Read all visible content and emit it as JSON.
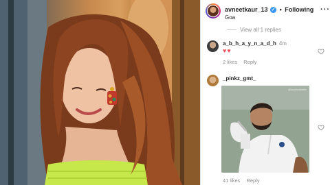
{
  "post": {
    "username": "avneetkaur_13",
    "follow_status": "Following",
    "location": "Goa"
  },
  "replies": {
    "view_label": "View all 1 replies"
  },
  "comments": [
    {
      "username": "a_b_h_a_y_n_a_d_h",
      "time": "4m",
      "text": "♥♥",
      "likes": "2 likes",
      "reply": "Reply"
    },
    {
      "username": "_pinkz_gmt_",
      "gif_watermark": "@lazyfootballtv",
      "likes": "41 likes",
      "reply": "Reply"
    }
  ],
  "icons": {
    "verified": "verified-badge-icon",
    "more": "more-options-icon",
    "like": "heart-outline-icon"
  },
  "colors": {
    "accent_blue": "#3897f0",
    "heart_red": "#ed4956",
    "secondary_text": "#8e8e8e"
  }
}
